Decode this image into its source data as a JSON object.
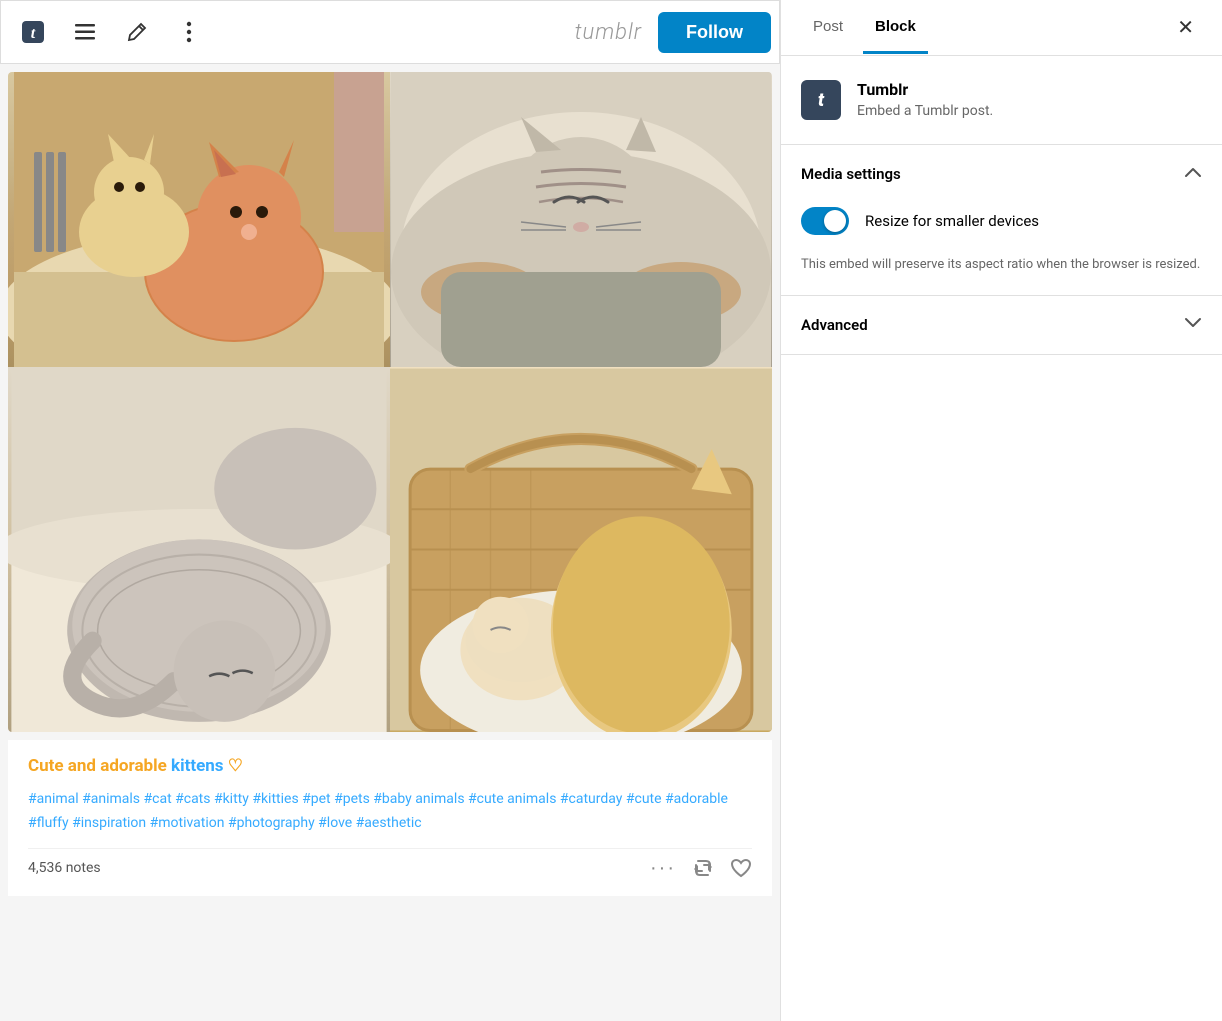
{
  "toolbar": {
    "logo_icon": "t",
    "align_icon": "≡",
    "edit_icon": "✏",
    "more_icon": "⋮",
    "wordmark": "tumblr",
    "follow_label": "Follow"
  },
  "post": {
    "title": "Cute and adorable kittens ♡",
    "title_yellow": "Cute and adorable ",
    "title_blue": "kittens",
    "title_heart": " ♡",
    "tags": "#animal  #animals  #cat  #cats  #kitty  #kitties  #pet  #pets  #baby animals  #cute animals  #caturday  #cute  #adorable  #fluffy  #inspiration  #motivation  #photography  #love  #aesthetic",
    "notes_count": "4,536 notes",
    "actions": {
      "more": "···",
      "reblog": "⟳",
      "like": "♡"
    }
  },
  "sidebar": {
    "tabs": [
      {
        "label": "Post",
        "active": false
      },
      {
        "label": "Block",
        "active": true
      }
    ],
    "close_icon": "✕",
    "block_info": {
      "icon": "t",
      "title": "Tumblr",
      "description": "Embed a Tumblr post."
    },
    "media_settings": {
      "section_title": "Media settings",
      "chevron": "∧",
      "toggle_label": "Resize for smaller devices",
      "toggle_enabled": true,
      "description": "This embed will preserve its aspect ratio when the browser is resized."
    },
    "advanced": {
      "section_title": "Advanced",
      "chevron": "∨"
    }
  }
}
